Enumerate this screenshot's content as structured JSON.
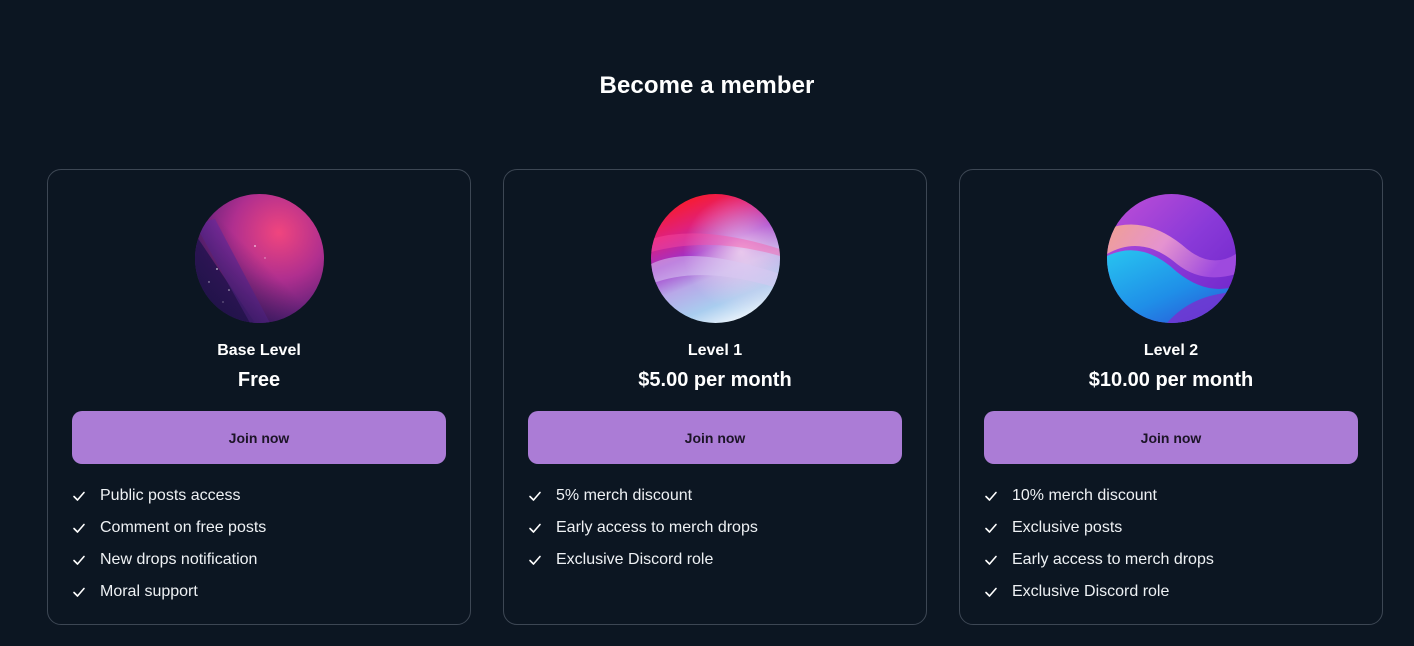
{
  "heading": "Become a member",
  "tiers": [
    {
      "name": "Base Level",
      "price": "Free",
      "join_label": "Join now",
      "avatar_icon": "abstract-pink-purple-art",
      "benefits": [
        "Public posts access",
        "Comment on free posts",
        "New drops notification",
        "Moral support"
      ]
    },
    {
      "name": "Level 1",
      "price": "$5.00 per month",
      "join_label": "Join now",
      "avatar_icon": "abstract-red-purple-gradient",
      "benefits": [
        "5% merch discount",
        "Early access to merch drops",
        "Exclusive Discord role"
      ]
    },
    {
      "name": "Level 2",
      "price": "$10.00 per month",
      "join_label": "Join now",
      "avatar_icon": "abstract-blue-purple-waves",
      "benefits": [
        "10% merch discount",
        "Exclusive posts",
        "Early access to merch drops",
        "Exclusive Discord role"
      ]
    }
  ],
  "colors": {
    "background": "#0c1622",
    "card_border": "#3d4754",
    "button": "#ab7cd6",
    "button_text": "#1c1427"
  }
}
